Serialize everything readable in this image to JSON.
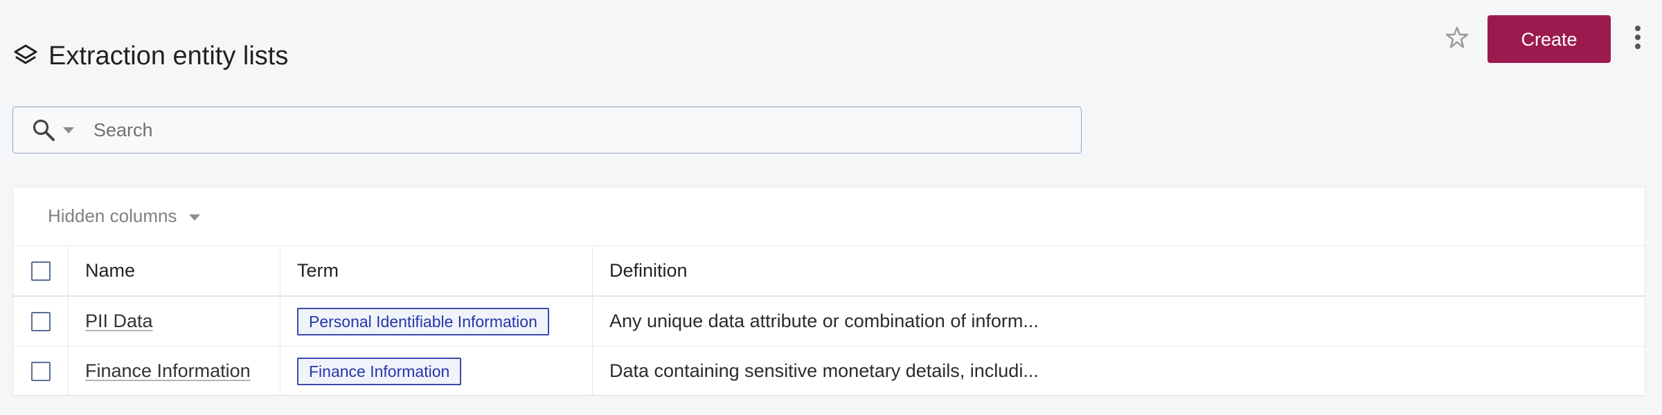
{
  "header": {
    "title": "Extraction entity lists",
    "icon": "layers-icon",
    "favorite_icon": "star-icon",
    "create_label": "Create",
    "more_icon": "more-vertical-icon"
  },
  "search": {
    "placeholder": "Search",
    "value": "",
    "icon": "search-icon",
    "caret_icon": "caret-down-icon"
  },
  "table": {
    "toolbar": {
      "hidden_columns_label": "Hidden columns",
      "hidden_columns_icon": "caret-down-icon"
    },
    "columns": [
      "Name",
      "Term",
      "Definition"
    ],
    "rows": [
      {
        "name": "PII Data",
        "term": "Personal Identifiable Information",
        "definition": "Any unique data attribute or combination of inform..."
      },
      {
        "name": "Finance Information",
        "term": "Finance Information",
        "definition": "Data containing sensitive monetary details, includi..."
      }
    ]
  },
  "colors": {
    "primary_button": "#9b1b4f",
    "badge_border": "#3949ab",
    "badge_text": "#2336a7",
    "search_border": "#8ea2c6",
    "background": "#f5f6f8"
  }
}
